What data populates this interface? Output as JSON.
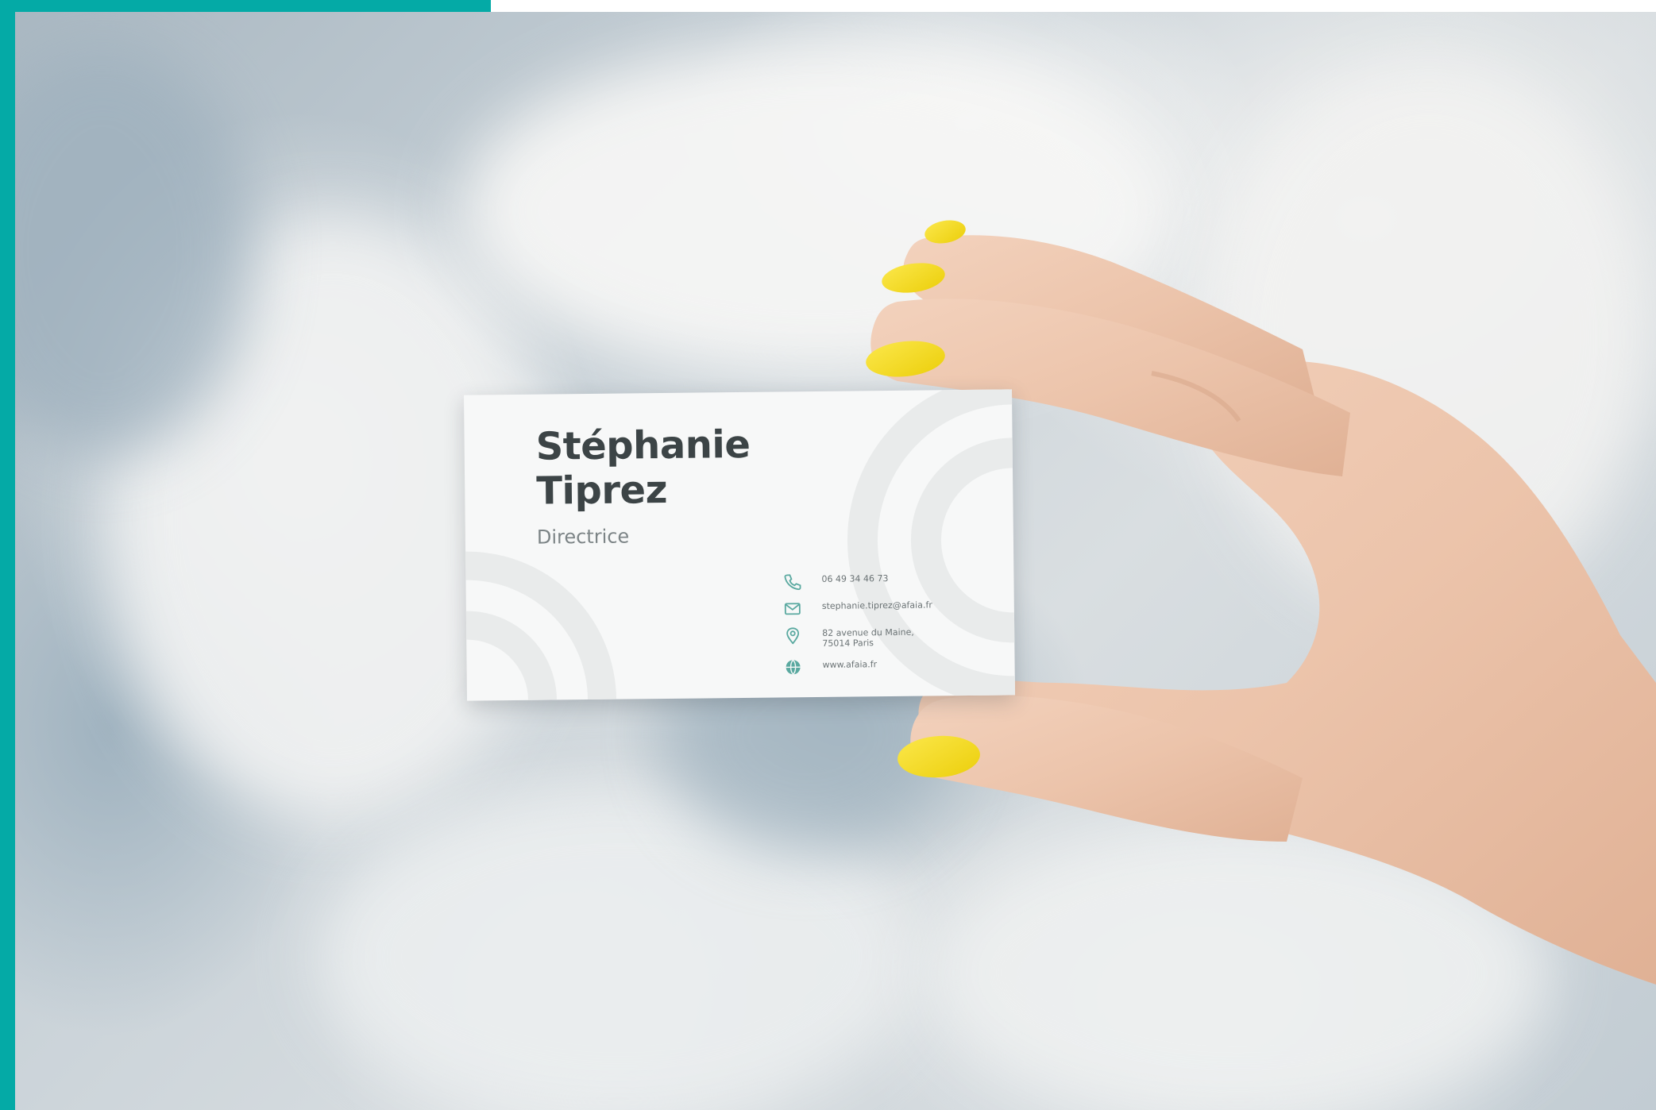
{
  "colors": {
    "frame_teal": "#04aaa6",
    "nail_yellow": "#f4dc1c",
    "card_icon_teal": "#5aa9a0",
    "card_text_dark": "#3c4446"
  },
  "card": {
    "name_line1": "Stéphanie",
    "name_line2": "Tiprez",
    "role": "Directrice",
    "contacts": {
      "phone": "06 49 34 46 73",
      "email": "stephanie.tiprez@afaia.fr",
      "address_line1": "82 avenue du Maine,",
      "address_line2": "75014 Paris",
      "website": "www.afaia.fr"
    },
    "icons": [
      "phone-icon",
      "mail-icon",
      "location-pin-icon",
      "globe-icon"
    ]
  }
}
